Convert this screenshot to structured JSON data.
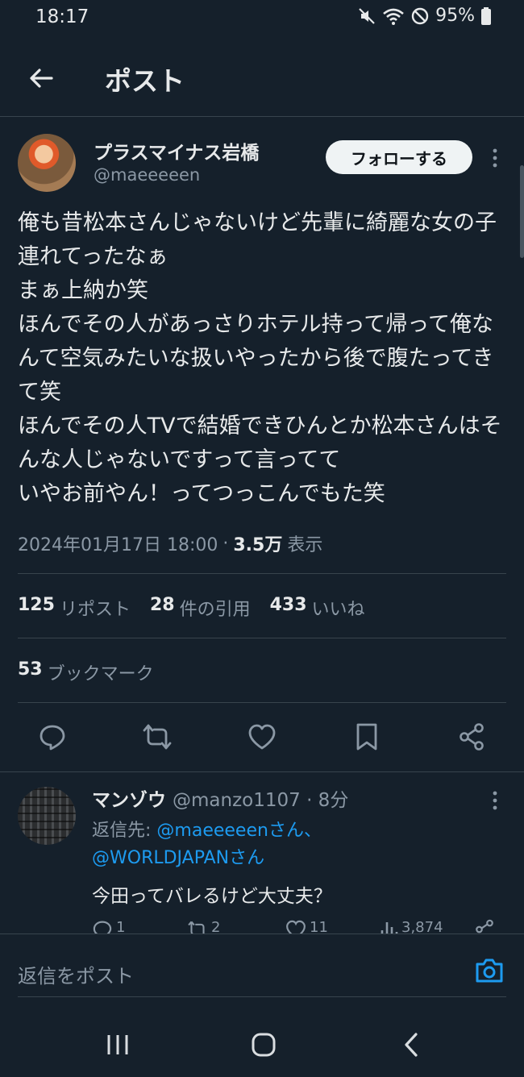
{
  "status_bar": {
    "time": "18:17",
    "battery": "95%"
  },
  "header": {
    "title": "ポスト"
  },
  "post": {
    "author_name": "プラスマイナス岩橋",
    "author_handle": "@maeeeeen",
    "follow_label": "フォローする",
    "text": "俺も昔松本さんじゃないけど先輩に綺麗な女の子連れてったなぁ\nまぁ上納か笑\nほんでその人があっさりホテル持って帰って俺なんて空気みたいな扱いやったから後で腹たってきて笑\nほんでその人TVで結婚できひんとか松本さんはそんな人じゃないですって言ってて\nいやお前やん！ってつっこんでもた笑",
    "datetime": "2024年01月17日 18:00",
    "separator": "·",
    "views": "3.5万",
    "views_label": "表示",
    "reposts": "125",
    "reposts_label": "リポスト",
    "quotes": "28",
    "quotes_label": "件の引用",
    "likes": "433",
    "likes_label": "いいね",
    "bookmarks": "53",
    "bookmarks_label": "ブックマーク"
  },
  "reply": {
    "name": "マンゾウ",
    "handle": "@manzo1107 · 8分",
    "reply_to_prefix": "返信先: ",
    "mention1": "@maeeeeenさん、",
    "mention2": "@WORLDJAPANさん",
    "text": "今田ってバレるけど大丈夫？",
    "replies": "1",
    "reposts": "2",
    "likes": "11",
    "views": "3,874"
  },
  "composer": {
    "placeholder": "返信をポスト"
  },
  "colors": {
    "background": "#15202b",
    "accent": "#1d9bf0",
    "text": "#e7e9ea",
    "muted": "#8b98a5",
    "divider": "#38444d"
  }
}
